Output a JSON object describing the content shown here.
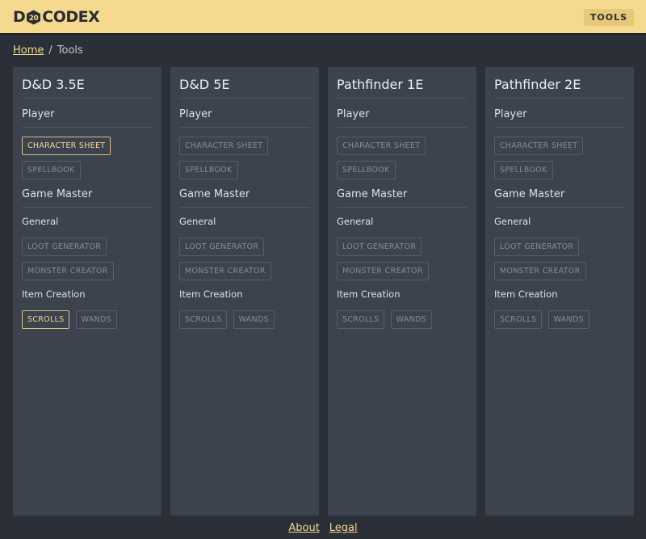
{
  "header": {
    "logo_left": "D",
    "logo_die": "20",
    "logo_right": "CODEX",
    "tools_label": "TOOLS"
  },
  "breadcrumb": {
    "home": "Home",
    "separator": "/",
    "current": "Tools"
  },
  "columns": [
    {
      "title": "D&D 3.5E",
      "player_heading": "Player",
      "player_buttons": [
        "CHARACTER SHEET",
        "SPELLBOOK"
      ],
      "gm_heading": "Game Master",
      "general_heading": "General",
      "general_buttons": [
        "LOOT GENERATOR",
        "MONSTER CREATOR"
      ],
      "item_heading": "Item Creation",
      "item_buttons": [
        "SCROLLS",
        "WANDS"
      ]
    },
    {
      "title": "D&D 5E",
      "player_heading": "Player",
      "player_buttons": [
        "CHARACTER SHEET",
        "SPELLBOOK"
      ],
      "gm_heading": "Game Master",
      "general_heading": "General",
      "general_buttons": [
        "LOOT GENERATOR",
        "MONSTER CREATOR"
      ],
      "item_heading": "Item Creation",
      "item_buttons": [
        "SCROLLS",
        "WANDS"
      ]
    },
    {
      "title": "Pathfinder 1E",
      "player_heading": "Player",
      "player_buttons": [
        "CHARACTER SHEET",
        "SPELLBOOK"
      ],
      "gm_heading": "Game Master",
      "general_heading": "General",
      "general_buttons": [
        "LOOT GENERATOR",
        "MONSTER CREATOR"
      ],
      "item_heading": "Item Creation",
      "item_buttons": [
        "SCROLLS",
        "WANDS"
      ]
    },
    {
      "title": "Pathfinder 2E",
      "player_heading": "Player",
      "player_buttons": [
        "CHARACTER SHEET",
        "SPELLBOOK"
      ],
      "gm_heading": "Game Master",
      "general_heading": "General",
      "general_buttons": [
        "LOOT GENERATOR",
        "MONSTER CREATOR"
      ],
      "item_heading": "Item Creation",
      "item_buttons": [
        "SCROLLS",
        "WANDS"
      ]
    }
  ],
  "footer": {
    "about": "About",
    "legal": "Legal"
  },
  "colors": {
    "accent": "#f4d98e",
    "background": "#2a2f38",
    "panel": "#3c434e"
  }
}
